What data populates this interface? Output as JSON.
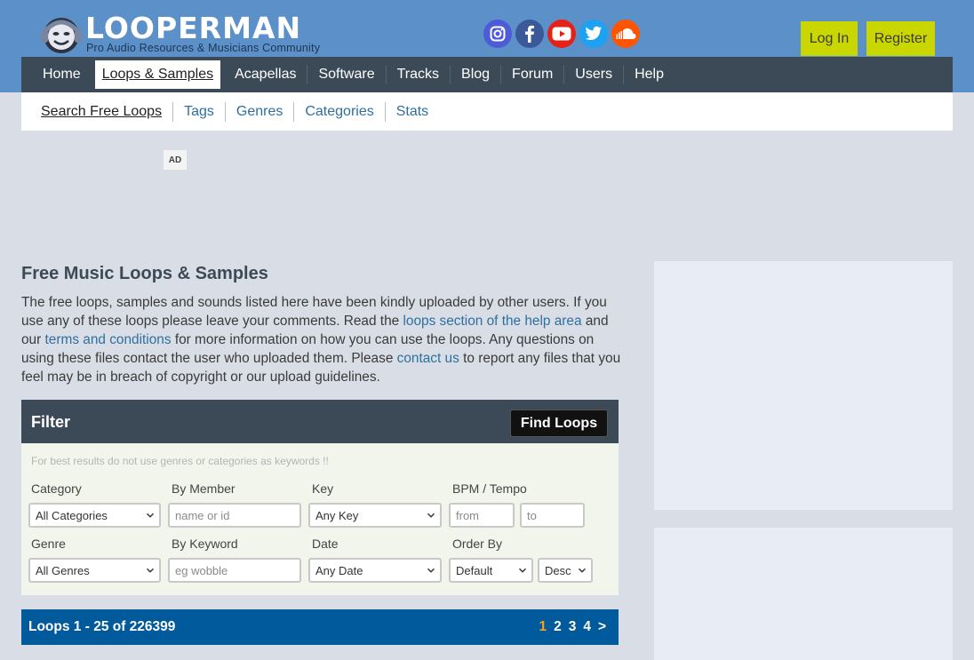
{
  "header": {
    "logo_text": "LOOPERMAN",
    "tagline": "Pro Audio Resources & Musicians Community",
    "social": [
      {
        "name": "instagram-icon",
        "color": "#4e5bd6"
      },
      {
        "name": "facebook-icon",
        "color": "#3b5998"
      },
      {
        "name": "youtube-icon",
        "color": "#e62117"
      },
      {
        "name": "twitter-icon",
        "color": "#1da1f2"
      },
      {
        "name": "soundcloud-icon",
        "color": "#ff5500"
      }
    ],
    "login_label": "Log In",
    "register_label": "Register"
  },
  "nav": {
    "items": [
      "Home",
      "Loops & Samples",
      "Acapellas",
      "Software",
      "Tracks",
      "Blog",
      "Forum",
      "Users",
      "Help"
    ],
    "active": "Loops & Samples"
  },
  "subnav": {
    "items": [
      "Search Free Loops",
      "Tags",
      "Genres",
      "Categories",
      "Stats"
    ]
  },
  "ad_label": "AD",
  "main": {
    "title": "Free Music Loops & Samples",
    "intro": {
      "t1": "The free loops, samples and sounds listed here have been kindly uploaded by other users. If you use any of these loops please leave your comments. Read the ",
      "link1": "loops section of the help area",
      "t2": " and our ",
      "link2": "terms and conditions",
      "t3": " for more information on how you can use the loops. Any questions on using these files contact the user who uploaded them. Please ",
      "link3": "contact us",
      "t4": " to report any files that you feel may be in breach of copyright or our upload guidelines."
    }
  },
  "filter": {
    "title": "Filter",
    "find_button": "Find Loops",
    "tip": "For best results do not use genres or categories as keywords !!",
    "category_label": "Category",
    "category_value": "All Categories",
    "member_label": "By Member",
    "member_placeholder": "name or id",
    "key_label": "Key",
    "key_value": "Any Key",
    "bpm_label": "BPM / Tempo",
    "bpm_from_placeholder": "from",
    "bpm_to_placeholder": "to",
    "genre_label": "Genre",
    "genre_value": "All Genres",
    "keyword_label": "By Keyword",
    "keyword_placeholder": "eg wobble",
    "date_label": "Date",
    "date_value": "Any Date",
    "order_label": "Order By",
    "order_value": "Default",
    "direction_value": "Desc"
  },
  "results": {
    "summary": "Loops 1 - 25 of 226399",
    "pages": [
      "1",
      "2",
      "3",
      "4"
    ],
    "current_page": "1",
    "next_label": ">"
  },
  "colors": {
    "header_blue": "#5b90c8",
    "nav_dark": "#3c4a57",
    "accent_yellow": "#cad600",
    "link_blue": "#2e6fa0",
    "pager_blue": "#005a9c",
    "current_page_orange": "#f7a21b"
  }
}
